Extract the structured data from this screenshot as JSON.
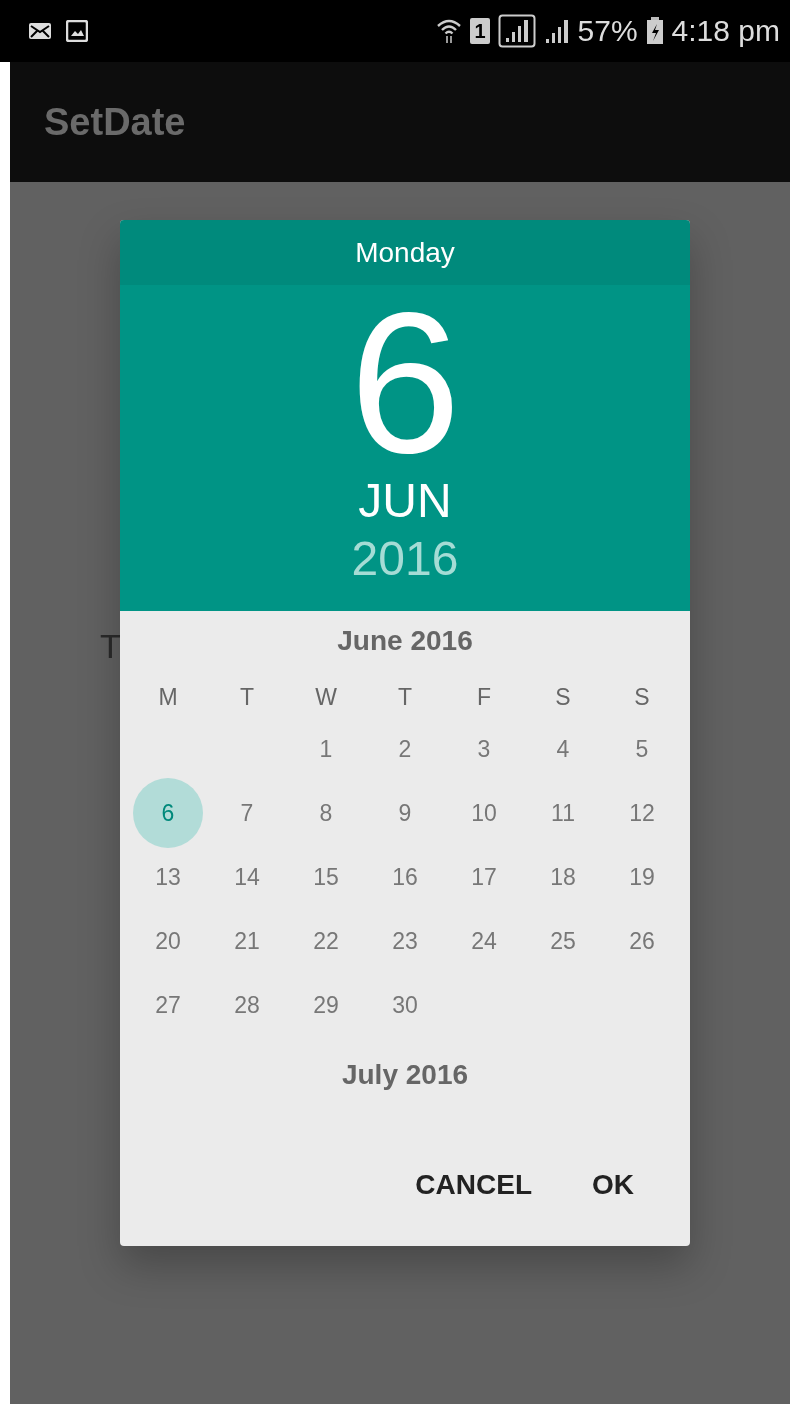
{
  "status_bar": {
    "sim_label": "1",
    "battery": "57%",
    "time": "4:18 pm"
  },
  "app_bar": {
    "title": "SetDate"
  },
  "background_text": "T",
  "dialog": {
    "weekday": "Monday",
    "day": "6",
    "month": "JUN",
    "year": "2016",
    "month_title": "June 2016",
    "weekday_headers": [
      "M",
      "T",
      "W",
      "T",
      "F",
      "S",
      "S"
    ],
    "weeks": [
      {
        "kind": "first_week",
        "days": [
          {
            "label": "1",
            "selected": false
          },
          {
            "label": "2",
            "selected": false
          },
          {
            "label": "3",
            "selected": false
          },
          {
            "label": "4",
            "selected": false
          },
          {
            "label": "5",
            "selected": false
          }
        ]
      },
      {
        "kind": "week",
        "days": [
          {
            "label": "6",
            "selected": true
          },
          {
            "label": "7",
            "selected": false
          },
          {
            "label": "8",
            "selected": false
          },
          {
            "label": "9",
            "selected": false
          },
          {
            "label": "10",
            "selected": false
          },
          {
            "label": "11",
            "selected": false
          },
          {
            "label": "12",
            "selected": false
          }
        ]
      },
      {
        "kind": "week",
        "days": [
          {
            "label": "13",
            "selected": false
          },
          {
            "label": "14",
            "selected": false
          },
          {
            "label": "15",
            "selected": false
          },
          {
            "label": "16",
            "selected": false
          },
          {
            "label": "17",
            "selected": false
          },
          {
            "label": "18",
            "selected": false
          },
          {
            "label": "19",
            "selected": false
          }
        ]
      },
      {
        "kind": "week",
        "days": [
          {
            "label": "20",
            "selected": false
          },
          {
            "label": "21",
            "selected": false
          },
          {
            "label": "22",
            "selected": false
          },
          {
            "label": "23",
            "selected": false
          },
          {
            "label": "24",
            "selected": false
          },
          {
            "label": "25",
            "selected": false
          },
          {
            "label": "26",
            "selected": false
          }
        ]
      },
      {
        "kind": "week",
        "days": [
          {
            "label": "27",
            "selected": false
          },
          {
            "label": "28",
            "selected": false
          },
          {
            "label": "29",
            "selected": false
          },
          {
            "label": "30",
            "selected": false
          }
        ]
      }
    ],
    "next_month_title": "July 2016",
    "buttons": [
      "CANCEL",
      "OK"
    ]
  }
}
